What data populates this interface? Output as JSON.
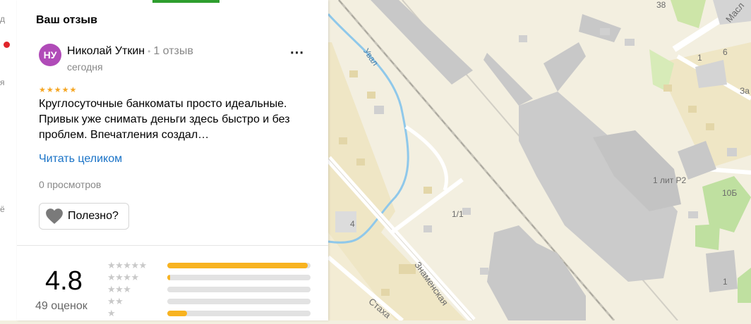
{
  "nav_strip": {
    "items": [
      "д",
      "я",
      "ё"
    ]
  },
  "review": {
    "section_title": "Ваш отзыв",
    "author_initials": "НУ",
    "author_name": "Николай Уткин",
    "separator": "•",
    "author_reviews": "1 отзыв",
    "date": "сегодня",
    "rating_stars": "★★★★★",
    "text": "Круглосуточные банкоматы просто идеальные. Привык уже снимать деньги здесь быстро и без проблем. Впечатления создал…",
    "read_more": "Читать целиком",
    "views": "0 просмотров",
    "useful_label": "Полезно?",
    "more_menu": "⋯"
  },
  "summary": {
    "rating": "4.8",
    "count": "49 оценок",
    "distribution": [
      {
        "stars": "★★★★★",
        "fraction": 0.98
      },
      {
        "stars": "★★★★",
        "fraction": 0.02
      },
      {
        "stars": "★★★",
        "fraction": 0.0
      },
      {
        "stars": "★★",
        "fraction": 0.0
      },
      {
        "stars": "★",
        "fraction": 0.14
      }
    ]
  },
  "map": {
    "labels": [
      "Увал",
      "Знаменская",
      "Стаха",
      "Масл",
      "38",
      "1",
      "6",
      "За",
      "1 лит Р2",
      "10Б",
      "1/1",
      "4",
      "1"
    ]
  },
  "colors": {
    "accent_green": "#2e9e2e",
    "link_blue": "#1a73c7",
    "star_yellow": "#f8b320",
    "avatar_purple": "#b04bb8",
    "map_background": "#f3efe0"
  }
}
